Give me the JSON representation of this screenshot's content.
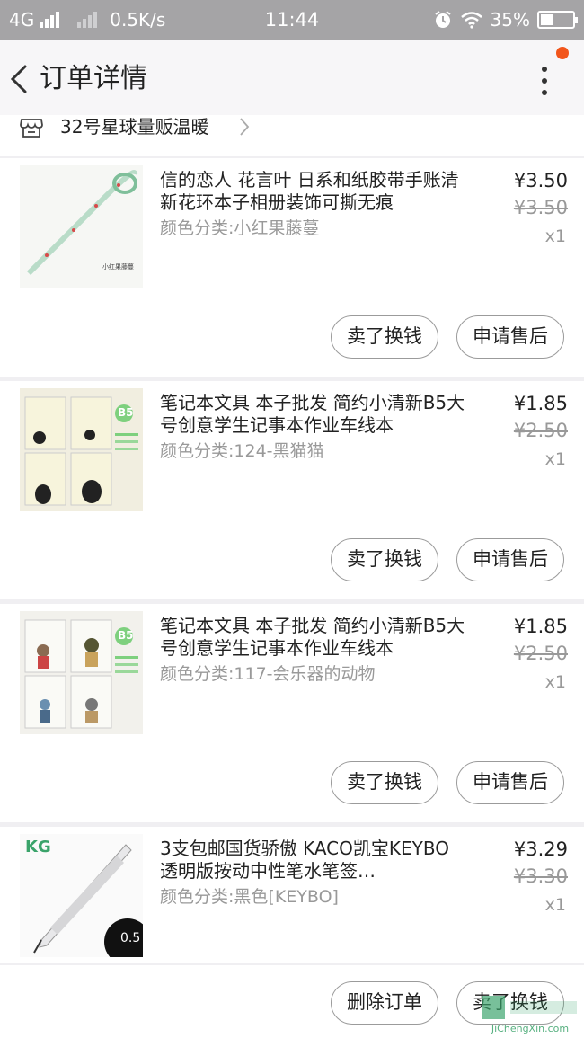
{
  "statusbar": {
    "network": "4G",
    "speed": "0.5K/s",
    "time": "11:44",
    "battery": "35%",
    "battery_level": 0.35,
    "icons": [
      "signal-icon",
      "signal-icon-dim",
      "alarm-icon",
      "wifi-icon",
      "battery-icon"
    ]
  },
  "nav": {
    "title": "订单详情",
    "back_icon": "back-chevron-icon",
    "more_icon": "more-vertical-icon",
    "badge_color": "#f2551b"
  },
  "store": {
    "name": "32号星球量贩温暖",
    "icon": "store-icon",
    "arrow_icon": "chevron-right-icon"
  },
  "items": [
    {
      "title": "信的恋人 花言叶 日系和纸胶带手账清新花环本子相册装饰可撕无痕",
      "sku": "颜色分类:小红果藤蔓",
      "price": "¥3.50",
      "original_price": "¥3.50",
      "qty": "x1",
      "thumb_caption": "小红果藤蔓",
      "sell_label": "卖了换钱",
      "after_label": "申请售后"
    },
    {
      "title": "笔记本文具 本子批发 简约小清新B5大号创意学生记事本作业车线本",
      "sku": "颜色分类:124-黑猫猫",
      "price": "¥1.85",
      "original_price": "¥2.50",
      "qty": "x1",
      "thumb_caption": "B5",
      "sell_label": "卖了换钱",
      "after_label": "申请售后"
    },
    {
      "title": "笔记本文具 本子批发 简约小清新B5大号创意学生记事本作业车线本",
      "sku": "颜色分类:117-会乐器的动物",
      "price": "¥1.85",
      "original_price": "¥2.50",
      "qty": "x1",
      "thumb_caption": "B5",
      "sell_label": "卖了换钱",
      "after_label": "申请售后"
    },
    {
      "title": "3支包邮国货骄傲 KACO凯宝KEYBO透明版按动中性笔水笔签…",
      "sku": "颜色分类:黑色[KEYBO]",
      "price": "¥3.29",
      "original_price": "¥3.30",
      "qty": "x1",
      "thumb_caption": "0.5",
      "thumb_brand": "KG"
    }
  ],
  "bottom": {
    "delete_label": "删除订单",
    "sell_label": "卖了换钱"
  },
  "watermark": {
    "text": "JiChengXin.com"
  }
}
